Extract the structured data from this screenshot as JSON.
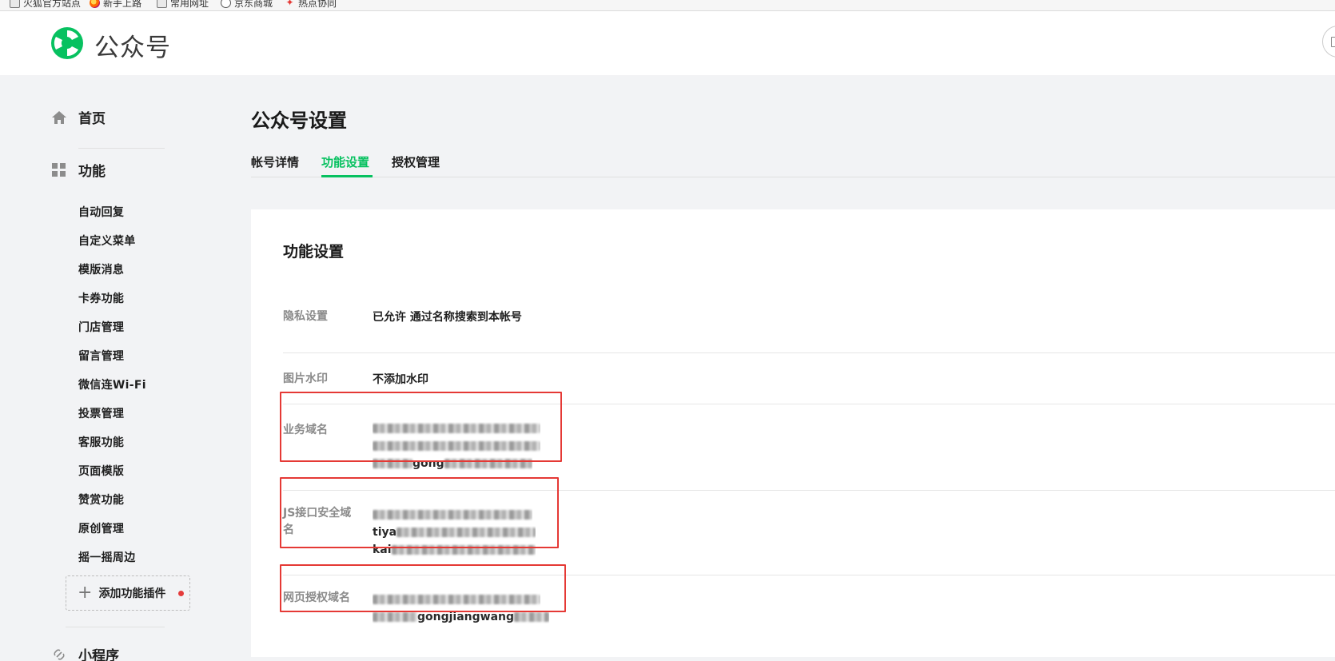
{
  "bookmarks": [
    {
      "icon": "folder-icon",
      "label": "火狐官方站点"
    },
    {
      "icon": "firefox-icon",
      "label": "新手上路"
    },
    {
      "icon": "folder-icon",
      "label": "常用网址"
    },
    {
      "icon": "globe-icon",
      "label": "京东商城"
    },
    {
      "icon": "fire-icon",
      "label": "热点协同"
    }
  ],
  "header": {
    "brand": "公众号",
    "logo_icon": "wechat-mp-logo",
    "accent": "#07c160"
  },
  "sidebar": {
    "home": {
      "icon": "home-icon",
      "label": "首页"
    },
    "features": {
      "icon": "grid-icon",
      "label": "功能"
    },
    "items": [
      {
        "label": "自动回复"
      },
      {
        "label": "自定义菜单"
      },
      {
        "label": "模版消息"
      },
      {
        "label": "卡券功能"
      },
      {
        "label": "门店管理"
      },
      {
        "label": "留言管理"
      },
      {
        "label": "微信连Wi-Fi"
      },
      {
        "label": "投票管理"
      },
      {
        "label": "客服功能"
      },
      {
        "label": "页面模版"
      },
      {
        "label": "赞赏功能"
      },
      {
        "label": "原创管理"
      },
      {
        "label": "摇一摇周边"
      }
    ],
    "add_plugin": {
      "label": "添加功能插件"
    },
    "miniprogram": {
      "icon": "link-icon",
      "label": "小程序"
    }
  },
  "main": {
    "title": "公众号设置",
    "tabs": [
      {
        "label": "帐号详情",
        "active": false
      },
      {
        "label": "功能设置",
        "active": true
      },
      {
        "label": "授权管理",
        "active": false
      }
    ],
    "card": {
      "title": "功能设置",
      "rows": [
        {
          "label": "隐私设置",
          "value": "已允许 通过名称搜索到本帐号"
        },
        {
          "label": "图片水印",
          "value": "不添加水印"
        },
        {
          "label": "业务域名",
          "lines": [
            "",
            "",
            "",
            "gong"
          ]
        },
        {
          "label": "JS接口安全域名",
          "lines": [
            "",
            "tiya",
            "kai"
          ]
        },
        {
          "label": "网页授权域名",
          "lines": [
            "",
            "gongjiangwang"
          ]
        }
      ]
    }
  }
}
